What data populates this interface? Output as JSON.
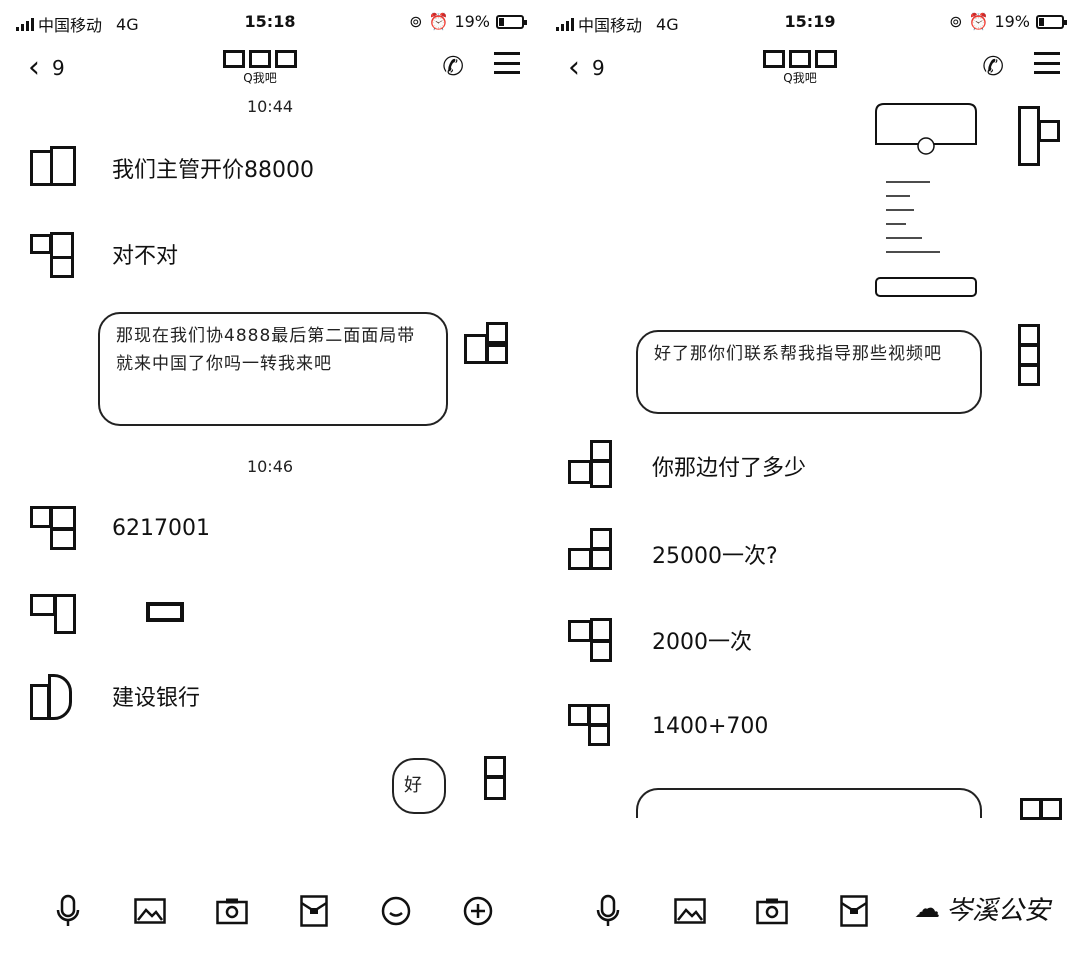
{
  "left": {
    "status": {
      "carrier": "中国移动",
      "network": "4G",
      "time": "15:18",
      "battery": "19%",
      "battery_level": 0.19
    },
    "nav": {
      "back_count": "9",
      "title_sub": "Q我吧"
    },
    "timestamps": [
      "10:44",
      "10:46"
    ],
    "messages": [
      {
        "text": "我们主管开价88000"
      },
      {
        "text": "对不对"
      },
      {
        "text": "6217001"
      },
      {
        "text": ""
      },
      {
        "text": "建设银行"
      }
    ],
    "out_bubble_1": {
      "text": "那现在我们协4888最后第二面面局带就来中国了你吗一转我来吧"
    },
    "out_bubble_2": {
      "text": "好"
    }
  },
  "right": {
    "status": {
      "carrier": "中国移动",
      "network": "4G",
      "time": "15:19",
      "battery": "19%",
      "battery_level": 0.19
    },
    "nav": {
      "back_count": "9",
      "title_sub": "Q我吧"
    },
    "out_bubble_1": {
      "text": "好了那你们联系帮我指导那些视频吧"
    },
    "messages": [
      {
        "text": "你那边付了多少"
      },
      {
        "text": "25000一次?"
      },
      {
        "text": "2000一次"
      },
      {
        "text": "1400+700"
      }
    ]
  },
  "toolbar": {
    "icons": [
      "microphone-icon",
      "image-icon",
      "camera-icon",
      "red-packet-icon",
      "emoji-icon",
      "plus-icon"
    ]
  },
  "watermark": {
    "text": "岑溪公安"
  }
}
